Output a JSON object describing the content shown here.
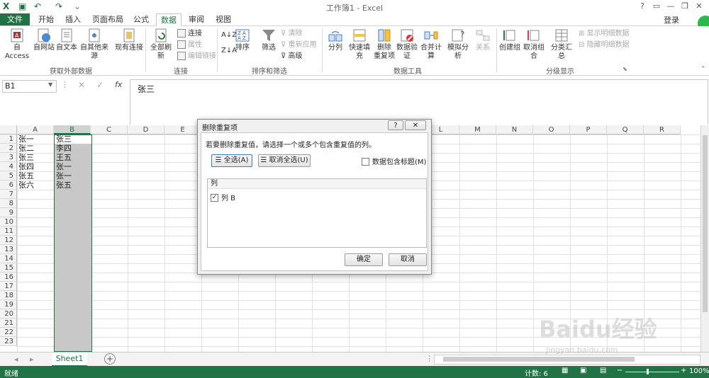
{
  "window": {
    "title": "工作簿1 - Excel",
    "login": "登录",
    "controls": [
      "?",
      "▭",
      "—",
      "❐",
      "✕"
    ]
  },
  "tabs": [
    "文件",
    "开始",
    "插入",
    "页面布局",
    "公式",
    "数据",
    "审阅",
    "视图"
  ],
  "active_tab": "数据",
  "ribbon": {
    "group_external": {
      "label": "获取外部数据",
      "buttons": [
        "自 Access",
        "自网站",
        "自文本",
        "自其他来源",
        "现有连接"
      ]
    },
    "group_connections": {
      "label": "连接",
      "big": "全部刷新",
      "small": [
        "连接",
        "属性",
        "编辑链接"
      ]
    },
    "group_sort": {
      "label": "排序和筛选",
      "buttons": [
        "排序",
        "筛选"
      ],
      "small": [
        "清除",
        "重新应用",
        "高级"
      ]
    },
    "group_tools": {
      "label": "数据工具",
      "buttons": [
        "分列",
        "快速填充",
        "删除\n重复项",
        "数据验\n证",
        "合并计算",
        "模拟分析",
        "关系"
      ]
    },
    "group_outline": {
      "label": "分级显示",
      "buttons": [
        "创建组",
        "取消组合",
        "分类汇总"
      ],
      "small": [
        "显示明细数据",
        "隐藏明细数据"
      ]
    }
  },
  "formula_bar": {
    "name_box": "B1",
    "fx": "fx",
    "content": "张三"
  },
  "sheet": {
    "columns": [
      "A",
      "B",
      "C",
      "D",
      "E",
      "F",
      "G",
      "H",
      "I",
      "J",
      "K",
      "L",
      "M",
      "N",
      "O",
      "P",
      "Q",
      "R"
    ],
    "row_count": 23,
    "col_a": [
      "张一",
      "张二",
      "张三",
      "张四",
      "张五",
      "张六"
    ],
    "col_b": [
      "张三",
      "李四",
      "王五",
      "张一",
      "张一",
      "张五"
    ]
  },
  "sheet_tabs": {
    "active": "Sheet1",
    "add": "+"
  },
  "status": {
    "ready": "就绪",
    "count": "计数: 6",
    "zoom": "100%"
  },
  "dialog": {
    "title": "删除重复项",
    "help": "?",
    "close": "✕",
    "instruction": "若要删除重复值，请选择一个或多个包含重复值的列。",
    "select_all": "全选(A)",
    "unselect_all": "取消全选(U)",
    "has_headers": "数据包含标题(M)",
    "list_header": "列",
    "list_items": [
      "列 B"
    ],
    "ok": "确定",
    "cancel": "取消"
  },
  "watermark": {
    "text": "Baidu经验",
    "url": "jingyan.baidu.com"
  },
  "colors": {
    "excel_green": "#217346",
    "selection": "#c8c8c8"
  }
}
